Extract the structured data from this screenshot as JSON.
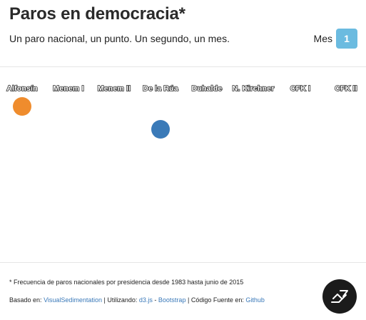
{
  "header": {
    "title": "Paros en democracia*",
    "subtitle": "Un paro nacional, un punto. Un segundo, un mes.",
    "mes_label": "Mes",
    "mes_value": "1"
  },
  "presidencies": [
    {
      "label": "Alfonsín"
    },
    {
      "label": "Menem I"
    },
    {
      "label": "Menem II"
    },
    {
      "label": "De la Rúa"
    },
    {
      "label": "Duhalde"
    },
    {
      "label": "N. Kirchner"
    },
    {
      "label": "CFK I"
    },
    {
      "label": "CFK II"
    }
  ],
  "points": [
    {
      "presidency": "Alfonsín",
      "color": "#ef8c2d"
    },
    {
      "presidency": "De la Rúa",
      "color": "#3a7ab8"
    }
  ],
  "footer": {
    "footnote": "* Frecuencia de paros nacionales por presidencia desde 1983 hasta junio de 2015",
    "based_on_prefix": "Basado en:",
    "based_on_link": "VisualSedimentation",
    "sep1": "|",
    "using_prefix": "Utilizando:",
    "d3_link": "d3.js",
    "dash": "-",
    "bootstrap_link": "Bootstrap",
    "sep2": "|",
    "source_prefix": "Código Fuente en:",
    "github_link": "Github"
  },
  "icons": {
    "github_button": "logo-icon"
  }
}
